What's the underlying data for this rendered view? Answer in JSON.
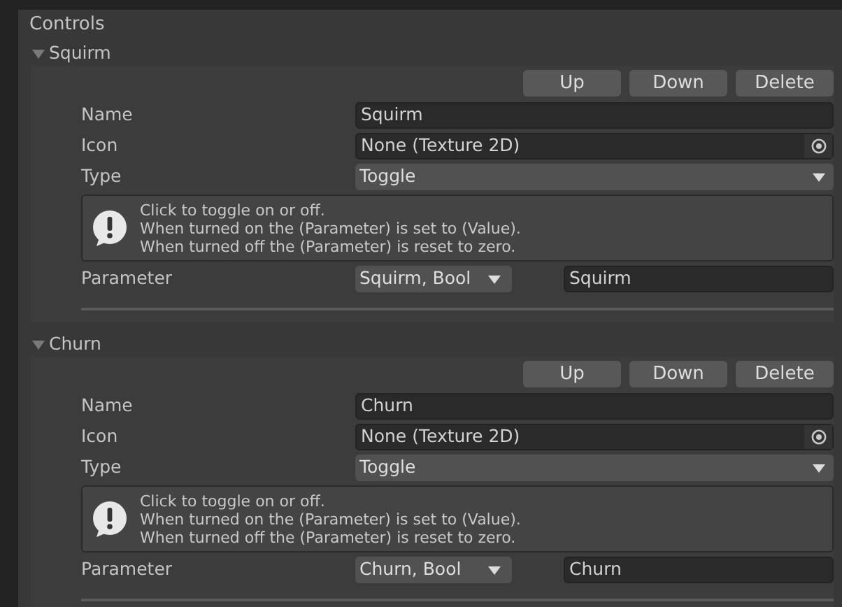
{
  "panel": {
    "title": "Controls"
  },
  "controls": [
    {
      "label": "Squirm",
      "expanded": true,
      "buttons": [
        "Up",
        "Down",
        "Delete"
      ],
      "fields": [
        {
          "kind": "text",
          "label": "Name",
          "value": "Squirm"
        },
        {
          "kind": "object",
          "label": "Icon",
          "value": "None (Texture 2D)"
        },
        {
          "kind": "dropdown",
          "label": "Type",
          "value": "Toggle"
        }
      ],
      "help": [
        "Click to toggle on or off.",
        "When turned on the (Parameter) is set to (Value).",
        "When turned off the (Parameter) is reset to zero."
      ],
      "parameter": {
        "label": "Parameter",
        "dropdown": "Squirm, Bool",
        "value": "Squirm"
      }
    },
    {
      "label": "Churn",
      "expanded": true,
      "buttons": [
        "Up",
        "Down",
        "Delete"
      ],
      "fields": [
        {
          "kind": "text",
          "label": "Name",
          "value": "Churn"
        },
        {
          "kind": "object",
          "label": "Icon",
          "value": "None (Texture 2D)"
        },
        {
          "kind": "dropdown",
          "label": "Type",
          "value": "Toggle"
        }
      ],
      "help": [
        "Click to toggle on or off.",
        "When turned on the (Parameter) is set to (Value).",
        "When turned off the (Parameter) is reset to zero."
      ],
      "parameter": {
        "label": "Parameter",
        "dropdown": "Churn, Bool",
        "value": "Churn"
      }
    }
  ]
}
